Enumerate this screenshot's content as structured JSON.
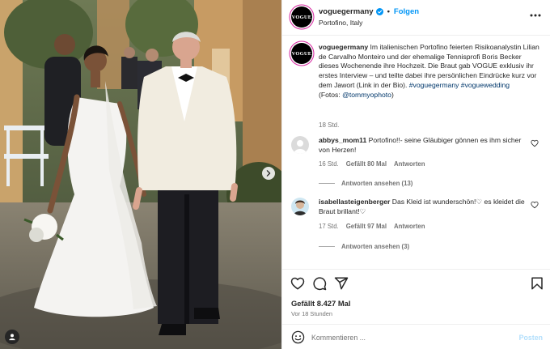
{
  "post": {
    "username": "voguegermany",
    "follow_label": "Folgen",
    "location": "Portofino, Italy",
    "avatar_text": "VOGUE",
    "caption": {
      "text": "Im italienischen Portofino feierten Risikoanalystin Lilian de Carvalho Monteiro und der ehemalige Tennisprofi Boris Becker dieses Wochenende ihre Hochzeit. Die Braut gab VOGUE exklusiv ihr erstes Interview – und teilte dabei ihre persönlichen Eindrücke kurz vor dem Jawort (Link in der Bio).",
      "hashtag1": "#voguegermany",
      "hashtag2": "#voguewedding",
      "credit_prefix": "(Fotos: ",
      "credit_handle": "@tommyophoto",
      "credit_suffix": ")",
      "time": "18 Std."
    },
    "comments": [
      {
        "username": "abbys_mom11",
        "text": "Portofino!!- seine Gläubiger gönnen es ihm sicher von Herzen!",
        "time": "16 Std.",
        "likes": "Gefällt 80 Mal",
        "reply_label": "Antworten",
        "view_replies": "Antworten ansehen (13)"
      },
      {
        "username": "isabellasteigenberger",
        "text": "Das Kleid ist wunderschön!♡ es kleidet die Braut brillant!♡",
        "time": "17 Std.",
        "likes": "Gefällt 97 Mal",
        "reply_label": "Antworten",
        "view_replies": "Antworten ansehen (3)"
      }
    ],
    "likes_count": "Gefällt 8.427 Mal",
    "age": "Vor 18 Stunden",
    "comment_placeholder": "Kommentieren ...",
    "post_label": "Posten"
  },
  "icons": {
    "verified": "verified-badge-icon",
    "more": "more-options-icon",
    "heart": "heart-icon",
    "comment": "comment-icon",
    "share": "share-icon",
    "save": "bookmark-icon",
    "emoji": "emoji-icon",
    "next": "chevron-right-icon",
    "tag": "user-tag-icon"
  },
  "colors": {
    "accent": "#0095f6",
    "link": "#00376b",
    "muted": "#737373",
    "post_disabled": "#b2dffc"
  }
}
